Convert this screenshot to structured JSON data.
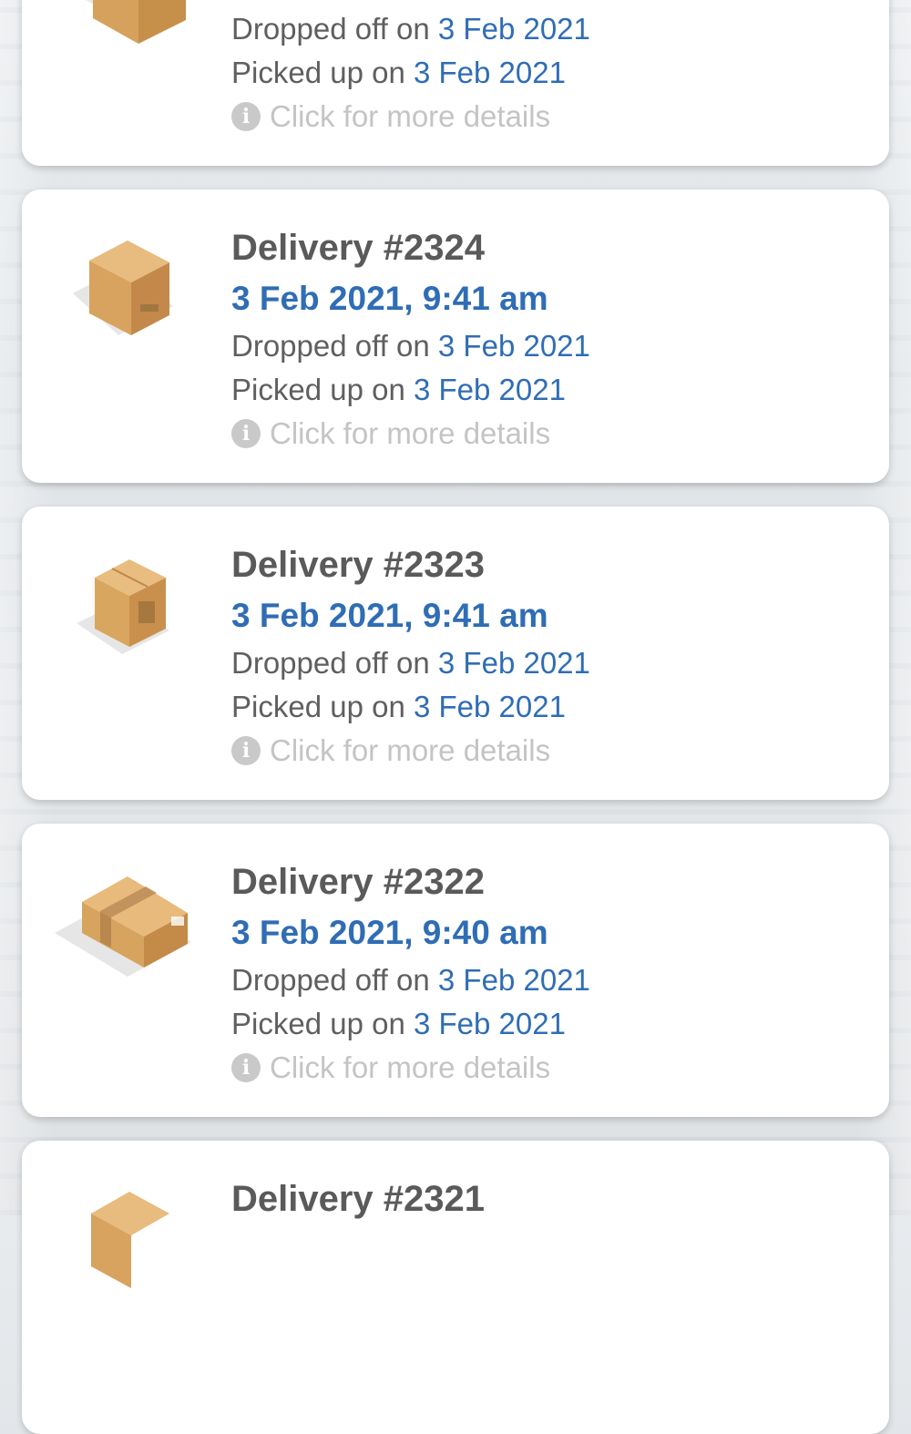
{
  "colors": {
    "accent": "#2f6db5",
    "title": "#5a5a5a",
    "muted": "#c4c4c4",
    "card": "#ffffff"
  },
  "deliveries": [
    {
      "title": "",
      "datetime": "",
      "dropped_prefix": "Dropped off on",
      "dropped_date": "3 Feb 2021",
      "picked_prefix": "Picked up on",
      "picked_date": "3 Feb 2021",
      "details_label": "Click for more details",
      "icon": "box-icon"
    },
    {
      "title": "Delivery #2324",
      "datetime": "3 Feb 2021, 9:41 am",
      "dropped_prefix": "Dropped off on",
      "dropped_date": "3 Feb 2021",
      "picked_prefix": "Picked up on",
      "picked_date": "3 Feb 2021",
      "details_label": "Click for more details",
      "icon": "box-icon"
    },
    {
      "title": "Delivery #2323",
      "datetime": "3 Feb 2021, 9:41 am",
      "dropped_prefix": "Dropped off on",
      "dropped_date": "3 Feb 2021",
      "picked_prefix": "Picked up on",
      "picked_date": "3 Feb 2021",
      "details_label": "Click for more details",
      "icon": "box-icon"
    },
    {
      "title": "Delivery #2322",
      "datetime": "3 Feb 2021, 9:40 am",
      "dropped_prefix": "Dropped off on",
      "dropped_date": "3 Feb 2021",
      "picked_prefix": "Picked up on",
      "picked_date": "3 Feb 2021",
      "details_label": "Click for more details",
      "icon": "box-icon"
    },
    {
      "title": "Delivery #2321",
      "datetime": "",
      "dropped_prefix": "",
      "dropped_date": "",
      "picked_prefix": "",
      "picked_date": "",
      "details_label": "",
      "icon": "box-icon"
    }
  ]
}
